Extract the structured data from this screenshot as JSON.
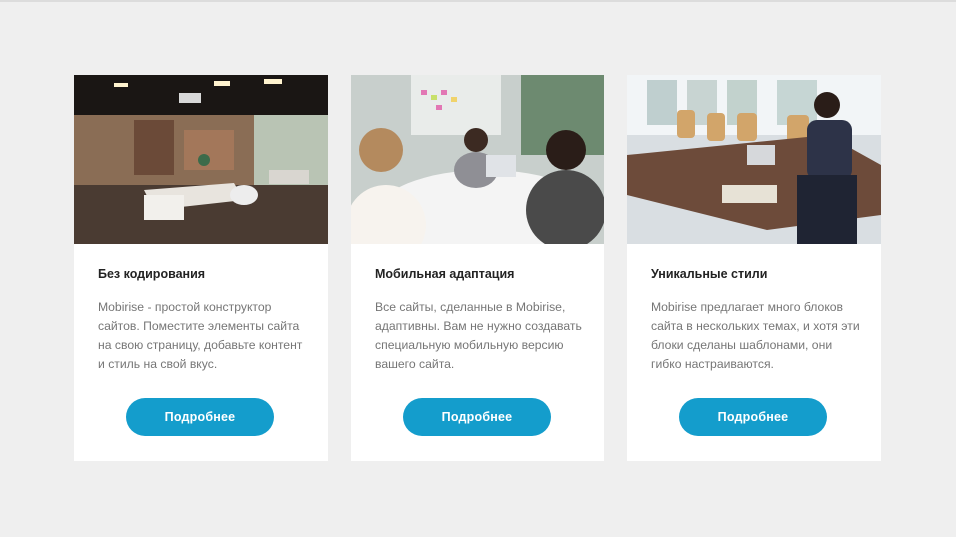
{
  "cards": [
    {
      "image_alt": "office-workspace-photo",
      "title": "Без кодирования",
      "text": "Mobirise - простой конструктор сайтов. Поместите элементы сайта на свою страницу, добавьте контент и стиль на свой вкус.",
      "button_label": "Подробнее"
    },
    {
      "image_alt": "team-meeting-photo",
      "title": "Мобильная адаптация",
      "text": "Все сайты, сделанные в Mobirise, адаптивны. Вам не нужно создавать специальную мобильную версию вашего сайта.",
      "button_label": "Подробнее"
    },
    {
      "image_alt": "conference-room-photo",
      "title": "Уникальные стили",
      "text": "Mobirise предлагает много блоков сайта в нескольких темах, и хотя эти блоки сделаны шаблонами, они гибко настраиваются.",
      "button_label": "Подробнее"
    }
  ],
  "colors": {
    "background": "#efefef",
    "card": "#ffffff",
    "button": "#149dcc",
    "title": "#232323",
    "text": "#767676"
  }
}
